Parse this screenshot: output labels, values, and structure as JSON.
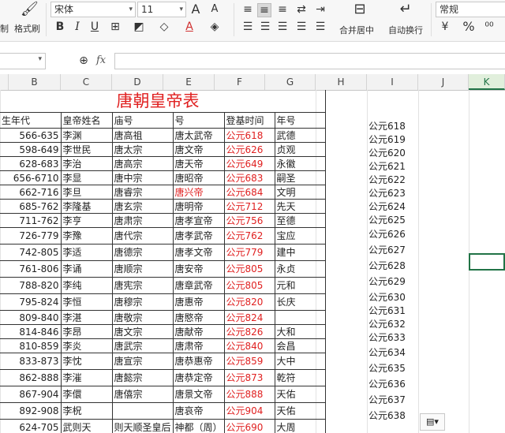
{
  "ribbon": {
    "clipboard_cut": "制",
    "format_painter": "格式刷",
    "font_name": "宋体",
    "font_size": "11",
    "merge_center": "合并居中",
    "wrap_text": "自动换行",
    "number_format": "常规",
    "percent": "%",
    "bold": "B",
    "italic": "I",
    "underline": "U",
    "font_grow": "A",
    "font_shrink": "A",
    "currency": "¥"
  },
  "formula_bar": {
    "fx": "fx",
    "value": ""
  },
  "columns": [
    "B",
    "C",
    "D",
    "E",
    "F",
    "G",
    "H",
    "I",
    "J",
    "K"
  ],
  "sheet": {
    "title": "唐朝皇帝表",
    "headers": [
      "生年代",
      "皇帝姓名",
      "庙号",
      "号",
      "登基时间",
      "年号"
    ],
    "rows": [
      [
        "566-635",
        "李渊",
        "唐高祖",
        "唐太武帝",
        "公元618",
        "武德"
      ],
      [
        "598-649",
        "李世民",
        "唐太宗",
        "唐文帝",
        "公元626",
        "贞观"
      ],
      [
        "628-683",
        "李治",
        "唐高宗",
        "唐天帝",
        "公元649",
        "永徽"
      ],
      [
        "656-6710",
        "李显",
        "唐中宗",
        "唐昭帝",
        "公元683",
        "嗣圣"
      ],
      [
        "662-716",
        "李旦",
        "唐睿宗",
        "唐兴帝",
        "公元684",
        "文明"
      ],
      [
        "685-762",
        "李隆基",
        "唐玄宗",
        "唐明帝",
        "公元712",
        "先天"
      ],
      [
        "711-762",
        "李亨",
        "唐肃宗",
        "唐孝宣帝",
        "公元756",
        "至德"
      ],
      [
        "726-779",
        "李豫",
        "唐代宗",
        "唐孝武帝",
        "公元762",
        "宝应"
      ],
      [
        "742-805",
        "李适",
        "唐德宗",
        "唐孝文帝",
        "公元779",
        "建中"
      ],
      [
        "761-806",
        "李诵",
        "唐顺宗",
        "唐安帝",
        "公元805",
        "永贞"
      ],
      [
        "788-820",
        "李纯",
        "唐宪宗",
        "唐章武帝",
        "公元805",
        "元和"
      ],
      [
        "795-824",
        "李恒",
        "唐穆宗",
        "唐惠帝",
        "公元820",
        "长庆"
      ],
      [
        "809-840",
        "李湛",
        "唐敬宗",
        "唐愍帝",
        "公元824",
        ""
      ],
      [
        "814-846",
        "李昂",
        "唐文宗",
        "唐献帝",
        "公元826",
        "大和"
      ],
      [
        "810-859",
        "李炎",
        "唐武宗",
        "唐肃帝",
        "公元840",
        "会昌"
      ],
      [
        "833-873",
        "李忱",
        "唐宣宗",
        "唐恭惠帝",
        "公元859",
        "大中"
      ],
      [
        "862-888",
        "李漼",
        "唐懿宗",
        "唐恭定帝",
        "公元873",
        "乾符"
      ],
      [
        "867-904",
        "李儇",
        "唐僖宗",
        "唐景文帝",
        "公元888",
        "天佑"
      ],
      [
        "892-908",
        "李柷",
        "",
        "唐哀帝",
        "公元904",
        "天佑"
      ],
      [
        "624-705",
        "武则天",
        "则天顺圣皇后",
        "神都（周）",
        "公元690",
        "大周"
      ]
    ],
    "col_i": [
      "公元618",
      "公元619",
      "公元620",
      "公元621",
      "公元622",
      "公元623",
      "公元624",
      "公元625",
      "公元626",
      "公元627",
      "公元628",
      "公元629",
      "公元630",
      "公元631",
      "公元632",
      "公元633",
      "公元634",
      "公元635",
      "公元636",
      "公元637",
      "公元638"
    ]
  },
  "colors": {
    "accent": "#217346",
    "red_text": "#e02020"
  }
}
